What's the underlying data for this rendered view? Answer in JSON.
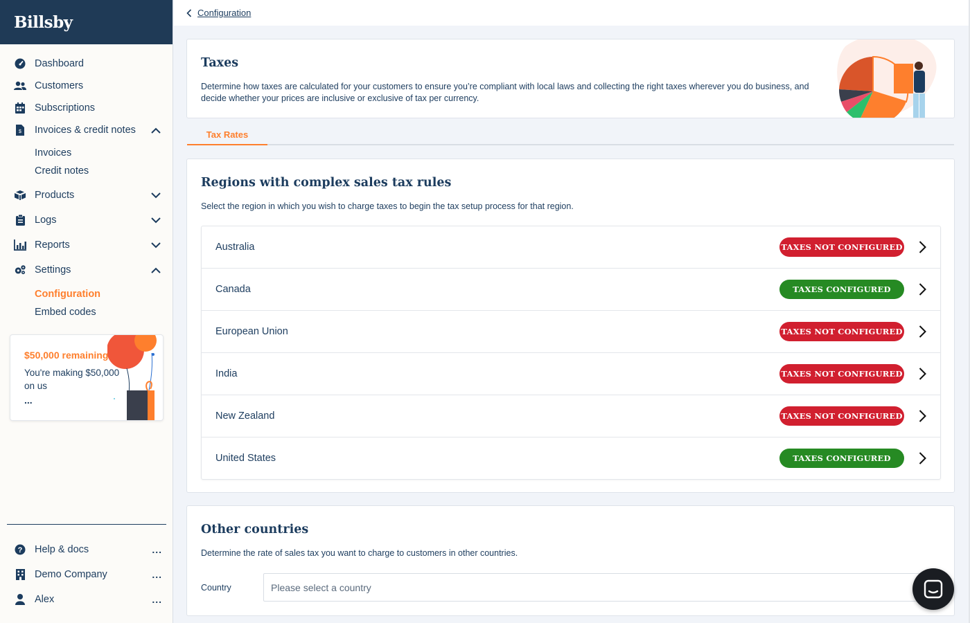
{
  "brand": {
    "logo": "Billsby"
  },
  "sidebar": {
    "items": [
      {
        "label": "Dashboard",
        "icon": "speedometer-icon"
      },
      {
        "label": "Customers",
        "icon": "users-icon"
      },
      {
        "label": "Subscriptions",
        "icon": "calendar-icon"
      },
      {
        "label": "Invoices & credit notes",
        "icon": "invoice-icon",
        "expanded": true,
        "children": [
          "Invoices",
          "Credit notes"
        ]
      },
      {
        "label": "Products",
        "icon": "boxes-icon",
        "expanded": false
      },
      {
        "label": "Logs",
        "icon": "clipboard-icon",
        "expanded": false
      },
      {
        "label": "Reports",
        "icon": "chart-icon",
        "expanded": false
      },
      {
        "label": "Settings",
        "icon": "gears-icon",
        "expanded": true,
        "children": [
          "Configuration",
          "Embed codes"
        ],
        "active_child": "Configuration"
      }
    ],
    "promo": {
      "title": "$50,000 remaining",
      "text": "You're making $50,000 on us",
      "more": "..."
    },
    "bottom": [
      {
        "label": "Help & docs",
        "icon": "help-icon",
        "more": "..."
      },
      {
        "label": "Demo Company",
        "icon": "building-icon",
        "more": "..."
      },
      {
        "label": "Alex",
        "icon": "user-icon",
        "more": "..."
      }
    ]
  },
  "breadcrumb": {
    "back_label": "Configuration"
  },
  "taxes": {
    "title": "Taxes",
    "description": "Determine how taxes are calculated for your customers to ensure you’re compliant with local laws and collecting the right taxes wherever you do business, and decide whether your prices are inclusive or exclusive of tax per currency."
  },
  "tabs": [
    {
      "label": "Tax Rates",
      "active": true
    }
  ],
  "regions": {
    "title": "Regions with complex sales tax rules",
    "description": "Select the region in which you wish to charge taxes to begin the tax setup process for that region.",
    "rows": [
      {
        "name": "Australia",
        "status": "TAXES NOT CONFIGURED",
        "configured": false
      },
      {
        "name": "Canada",
        "status": "TAXES CONFIGURED",
        "configured": true
      },
      {
        "name": "European Union",
        "status": "TAXES NOT CONFIGURED",
        "configured": false
      },
      {
        "name": "India",
        "status": "TAXES NOT CONFIGURED",
        "configured": false
      },
      {
        "name": "New Zealand",
        "status": "TAXES NOT CONFIGURED",
        "configured": false
      },
      {
        "name": "United States",
        "status": "TAXES CONFIGURED",
        "configured": true
      }
    ]
  },
  "other": {
    "title": "Other countries",
    "description": "Determine the rate of sales tax you want to charge to customers in other countries.",
    "country_label": "Country",
    "country_placeholder": "Please select a country",
    "country_value": ""
  },
  "colors": {
    "brand_dark": "#1f3a56",
    "accent": "#fe7f2d",
    "text": "#1c3c5e",
    "status_bad": "#d11f2f",
    "status_good": "#268a23"
  }
}
